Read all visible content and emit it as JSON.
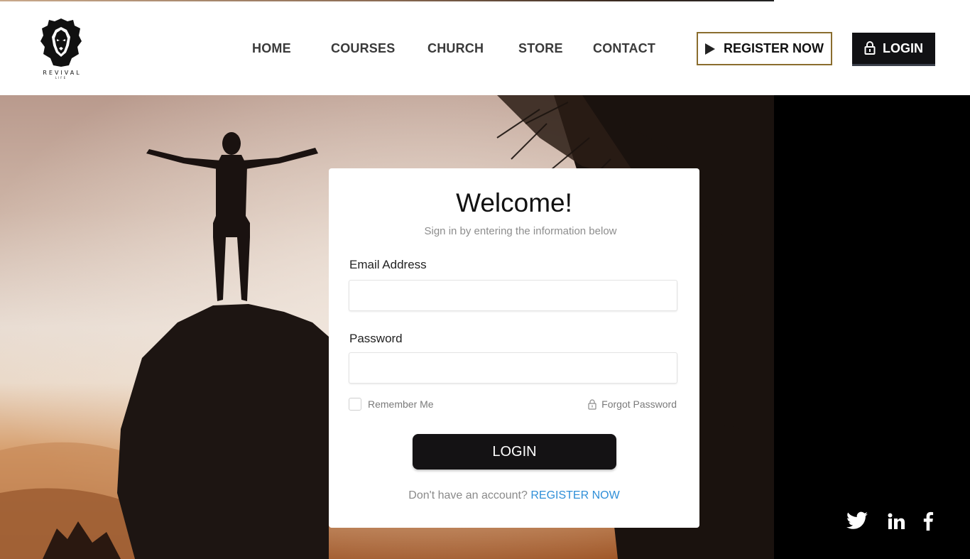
{
  "brand": {
    "name": "REVIVAL",
    "tagline": "LIFE"
  },
  "nav": {
    "items": [
      {
        "label": "HOME"
      },
      {
        "label": "COURSES"
      },
      {
        "label": "CHURCH"
      },
      {
        "label": "STORE"
      },
      {
        "label": "CONTACT"
      }
    ]
  },
  "header": {
    "register_label": "REGISTER NOW",
    "login_label": "LOGIN"
  },
  "login_card": {
    "title": "Welcome!",
    "subtitle": "Sign in by entering the information below",
    "email_label": "Email Address",
    "email_value": "",
    "password_label": "Password",
    "password_value": "",
    "remember_label": "Remember Me",
    "forgot_label": "Forgot Password",
    "submit_label": "LOGIN",
    "no_account_text": "Don't have an account?",
    "register_link": "REGISTER NOW"
  },
  "social": {
    "icons": [
      "twitter-icon",
      "linkedin-icon",
      "facebook-icon"
    ]
  },
  "colors": {
    "accent_gold": "#8a6d2e",
    "link_blue": "#2f8fd8",
    "dark_button": "#141214"
  }
}
